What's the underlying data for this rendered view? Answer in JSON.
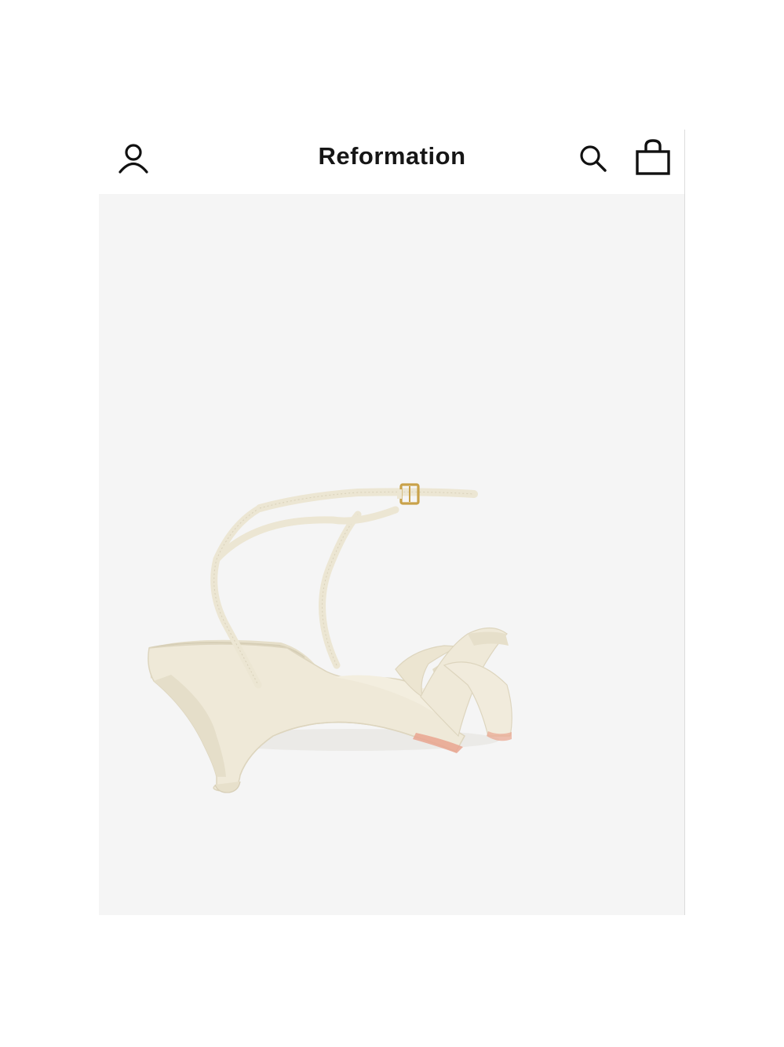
{
  "header": {
    "brand": "Reformation",
    "account_icon": "person-icon",
    "search_icon": "search-icon",
    "bag_icon": "shopping-bag-icon"
  },
  "product": {
    "image_subject": "sandal-image",
    "colors": {
      "background": "#f5f5f5",
      "leather": "#efe9d8",
      "buckle": "#c9a24a",
      "sole_edge": "#e9a58f"
    }
  }
}
